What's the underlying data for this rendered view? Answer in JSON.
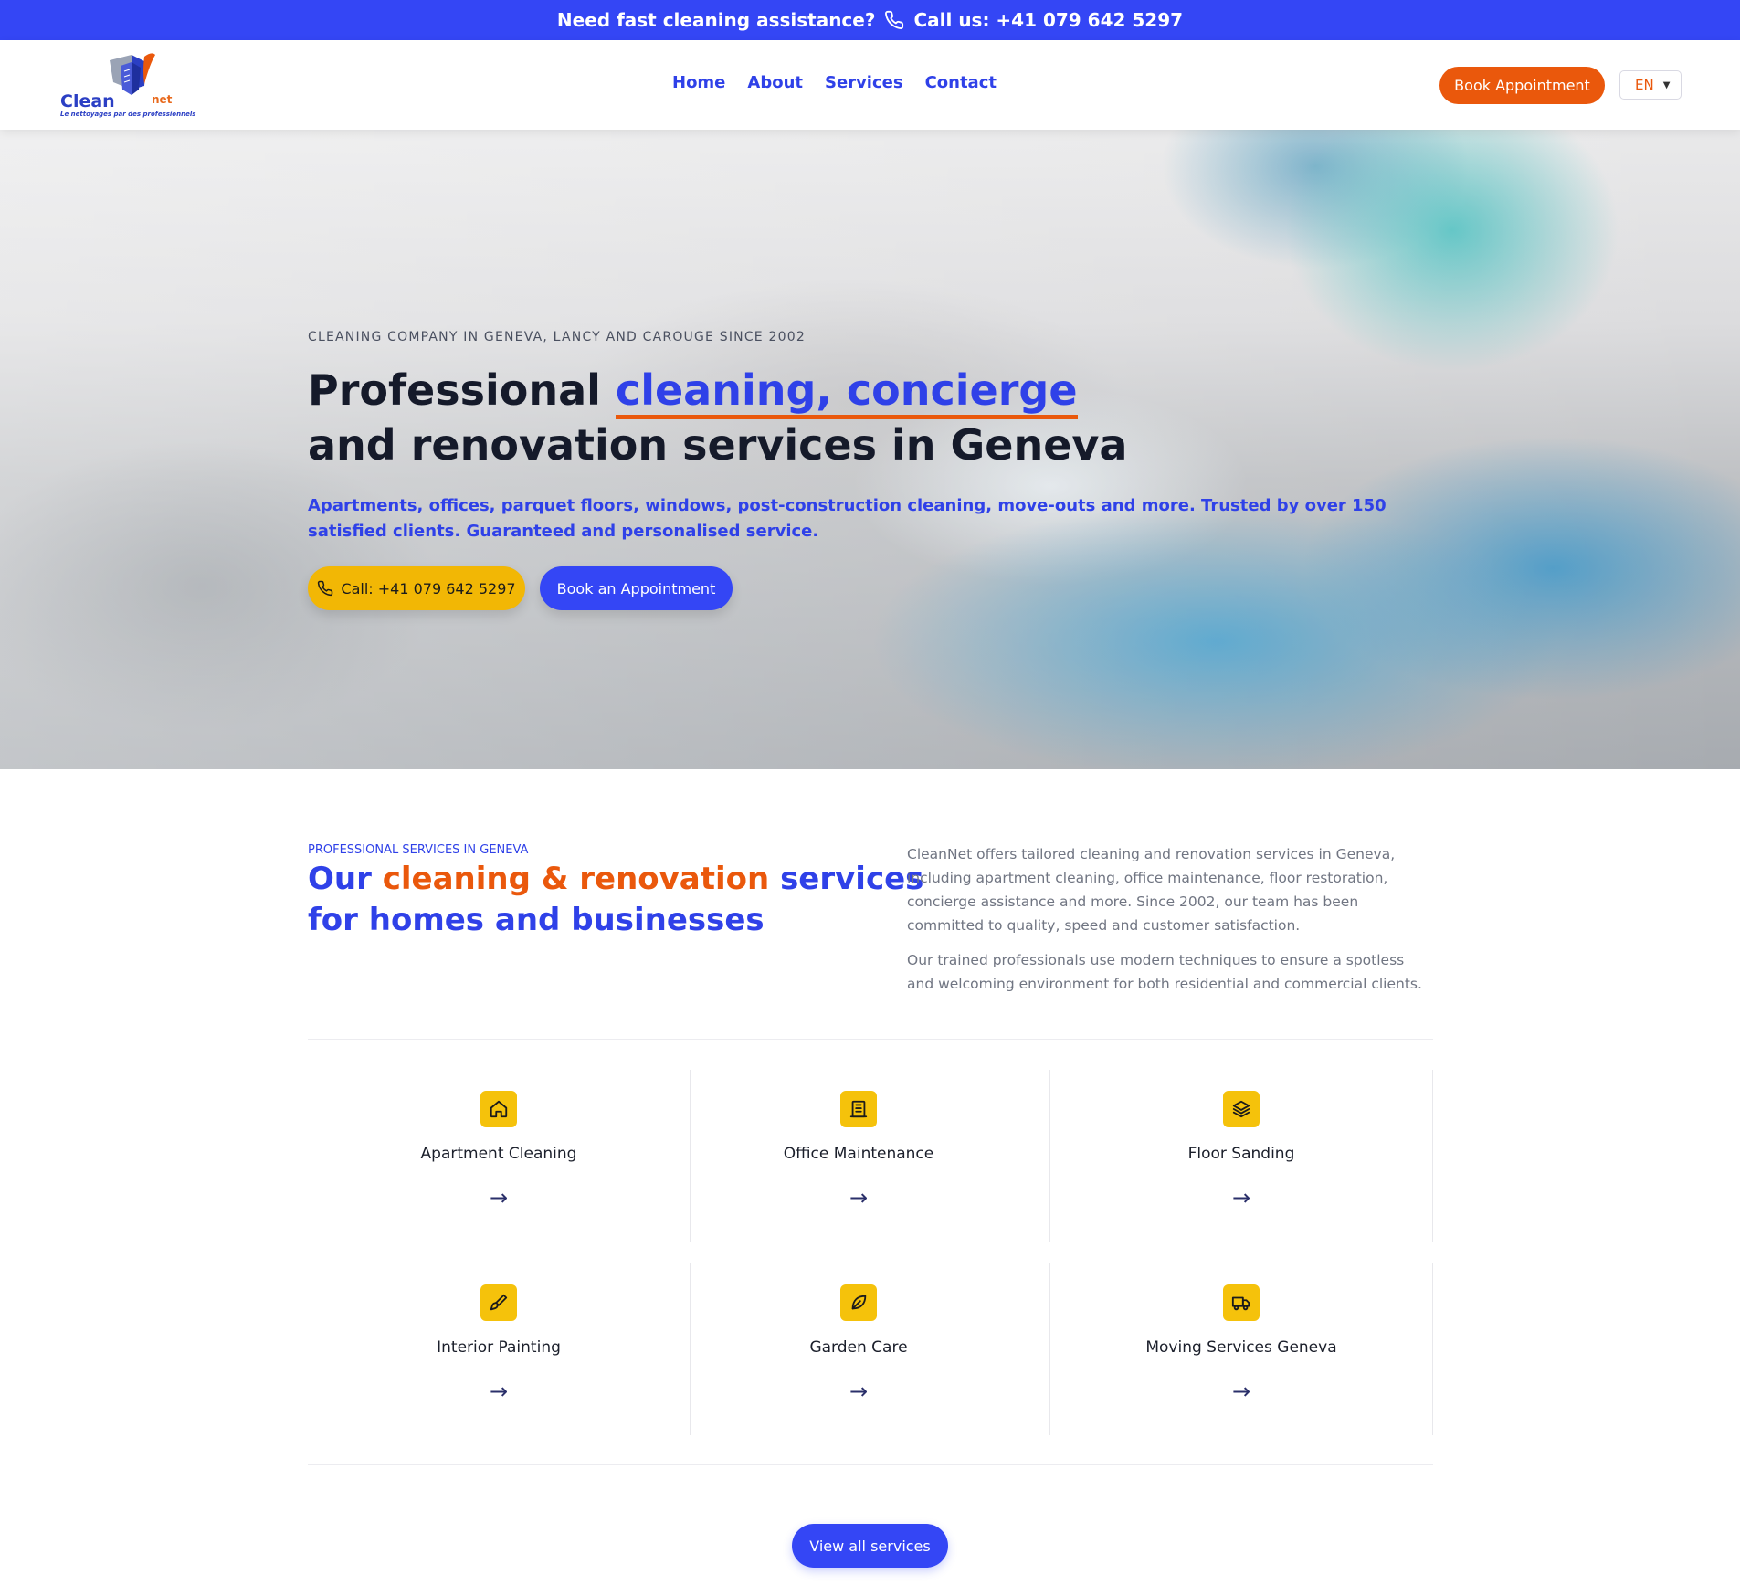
{
  "topbar": {
    "question": "Need fast cleaning assistance?",
    "call": "Call us: +41 079 642 5297"
  },
  "header": {
    "logo_word": "Clean",
    "logo_net": "net",
    "logo_tagline": "Le nettoyages par des professionnels",
    "nav": [
      "Home",
      "About",
      "Services",
      "Contact"
    ],
    "book_label": "Book Appointment",
    "language": "EN"
  },
  "hero": {
    "eyebrow": "CLEANING COMPANY IN GENEVA, LANCY AND CAROUGE SINCE 2002",
    "title_pre": "Professional ",
    "title_highlight": "cleaning, concierge",
    "title_line2": "and renovation services in Geneva",
    "subtitle": "Apartments, offices, parquet floors, windows, post-construction cleaning, move-outs and more. Trusted by over 150 satisfied clients. Guaranteed and personalised service.",
    "call_label": "Call: +41 079 642 5297",
    "appointment_label": "Book an Appointment"
  },
  "services": {
    "eyebrow": "PROFESSIONAL SERVICES IN GENEVA",
    "title_a": "Our ",
    "title_b": "cleaning & renovation",
    "title_c": " services",
    "title_line2": "for homes and businesses",
    "desc_1": "CleanNet offers tailored cleaning and renovation services in Geneva, including apartment cleaning, office maintenance, floor restoration, concierge assistance and more. Since 2002, our team has been committed to quality, speed and customer satisfaction.",
    "desc_2": "Our trained professionals use modern techniques to ensure a spotless and welcoming environment for both residential and commercial clients.",
    "items": [
      {
        "label": "Apartment Cleaning",
        "icon": "home-icon",
        "arrow": "→"
      },
      {
        "label": "Office Maintenance",
        "icon": "building-icon",
        "arrow": "→"
      },
      {
        "label": "Floor Sanding",
        "icon": "layers-icon",
        "arrow": "→"
      },
      {
        "label": "Interior Painting",
        "icon": "paintbrush-icon",
        "arrow": "→"
      },
      {
        "label": "Garden Care",
        "icon": "leaf-icon",
        "arrow": "→"
      },
      {
        "label": "Moving Services Geneva",
        "icon": "truck-icon",
        "arrow": "→"
      }
    ],
    "view_all": "View all services"
  },
  "colors": {
    "primary": "#3446f5",
    "accent": "#ea580c",
    "yellow": "#f2b705"
  }
}
